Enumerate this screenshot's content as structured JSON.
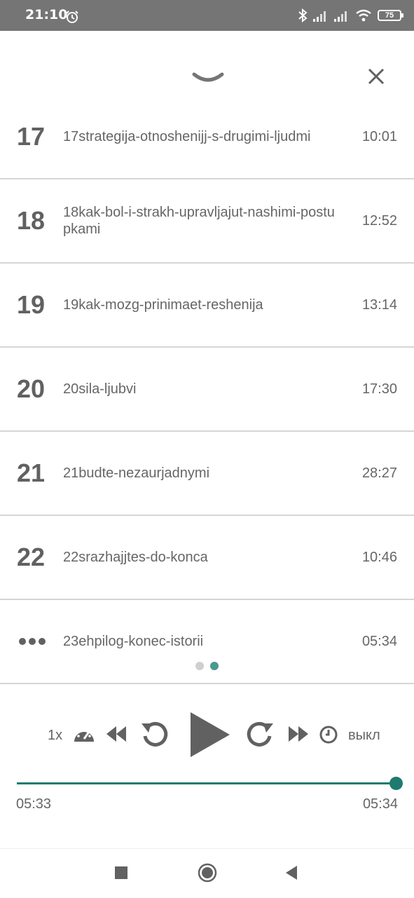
{
  "status_bar": {
    "time": "21:10",
    "battery": "75"
  },
  "playlist": [
    {
      "num": "17",
      "title": "17strategija-otnoshenijj-s-drugimi-ljudmi",
      "duration": "10:01"
    },
    {
      "num": "18",
      "title": "18kak-bol-i-strakh-upravljajut-nashimi-postupkami",
      "duration": "12:52"
    },
    {
      "num": "19",
      "title": "19kak-mozg-prinimaet-reshenija",
      "duration": "13:14"
    },
    {
      "num": "20",
      "title": "20sila-ljubvi",
      "duration": "17:30"
    },
    {
      "num": "21",
      "title": "21budte-nezaurjadnymi",
      "duration": "28:27"
    },
    {
      "num": "22",
      "title": "22srazhajjtes-do-konca",
      "duration": "10:46"
    },
    {
      "num": "",
      "title": "23ehpilog-konec-istorii",
      "duration": "05:34",
      "playing": true
    }
  ],
  "player": {
    "speed": "1x",
    "sleep_timer": "выкл",
    "elapsed": "05:33",
    "total": "05:34",
    "progress": 0.997
  },
  "colors": {
    "accent": "#1f7a70",
    "status_bar": "#757575",
    "icon": "#616161"
  },
  "icons": [
    "alarm-icon",
    "bluetooth-icon",
    "signal-icon",
    "wifi-icon",
    "battery-icon",
    "chevron-down-icon",
    "close-icon",
    "speedometer-icon",
    "fast-rewind-icon",
    "replay-icon",
    "play-icon",
    "forward-icon",
    "fast-forward-icon",
    "timer-icon",
    "stop-icon",
    "home-icon",
    "back-icon"
  ]
}
